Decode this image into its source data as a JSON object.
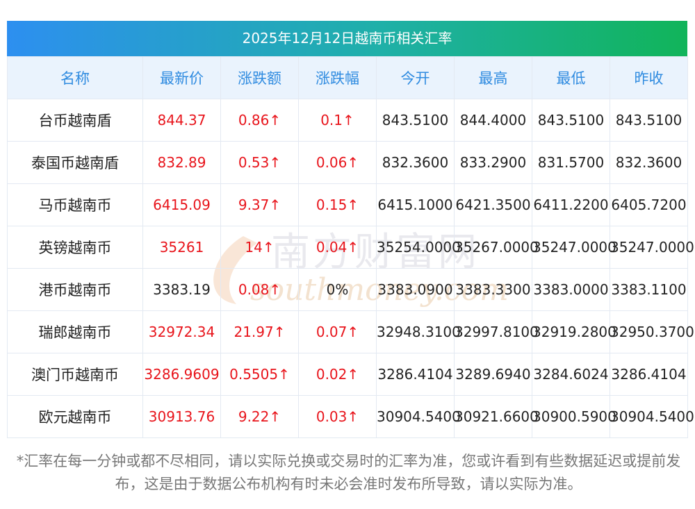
{
  "title": "2025年12月12日越南币相关汇率",
  "headers": [
    "名称",
    "最新价",
    "涨跌额",
    "涨跌幅",
    "今开",
    "最高",
    "最低",
    "昨收"
  ],
  "rows": [
    {
      "name": "台币越南盾",
      "latest": "844.37",
      "change": "0.86↑",
      "pct": "0.1↑",
      "open": "843.5100",
      "high": "844.4000",
      "low": "843.5100",
      "prev": "843.5100",
      "trend": "up"
    },
    {
      "name": "泰国币越南盾",
      "latest": "832.89",
      "change": "0.53↑",
      "pct": "0.06↑",
      "open": "832.3600",
      "high": "833.2900",
      "low": "831.5700",
      "prev": "832.3600",
      "trend": "up"
    },
    {
      "name": "马币越南币",
      "latest": "6415.09",
      "change": "9.37↑",
      "pct": "0.15↑",
      "open": "6415.1000",
      "high": "6421.3500",
      "low": "6411.2200",
      "prev": "6405.7200",
      "trend": "up"
    },
    {
      "name": "英镑越南币",
      "latest": "35261",
      "change": "14↑",
      "pct": "0.04↑",
      "open": "35254.0000",
      "high": "35267.0000",
      "low": "35247.0000",
      "prev": "35247.0000",
      "trend": "up"
    },
    {
      "name": "港币越南币",
      "latest": "3383.19",
      "change": "0.08↑",
      "pct": "0%",
      "open": "3383.0900",
      "high": "3383.3300",
      "low": "3383.0000",
      "prev": "3383.1100",
      "trend": "flat"
    },
    {
      "name": "瑞郎越南币",
      "latest": "32972.34",
      "change": "21.97↑",
      "pct": "0.07↑",
      "open": "32948.3100",
      "high": "32997.8100",
      "low": "32919.2800",
      "prev": "32950.3700",
      "trend": "up"
    },
    {
      "name": "澳门币越南币",
      "latest": "3286.9609",
      "change": "0.5505↑",
      "pct": "0.02↑",
      "open": "3286.4104",
      "high": "3289.6940",
      "low": "3284.6024",
      "prev": "3286.4104",
      "trend": "up"
    },
    {
      "name": "欧元越南币",
      "latest": "30913.76",
      "change": "9.22↑",
      "pct": "0.03↑",
      "open": "30904.5400",
      "high": "30921.6600",
      "low": "30900.5900",
      "prev": "30904.5400",
      "trend": "up"
    }
  ],
  "watermark": {
    "cn": "南方财富网",
    "en": "southmoney.com"
  },
  "footnote": "*汇率在每一分钟或都不尽相同，请以实际兑换或交易时的汇率为准，您或许看到有些数据延迟或提前发布，这是由于数据公布机构有时未必会准时发布所导致，请以实际为准。",
  "colors": {
    "up": "#e8141b",
    "header_text": "#2f8be0",
    "header_bg": "#eaf3fd",
    "title_gradient_start": "#2d8ff0",
    "title_gradient_end": "#11b45a"
  }
}
